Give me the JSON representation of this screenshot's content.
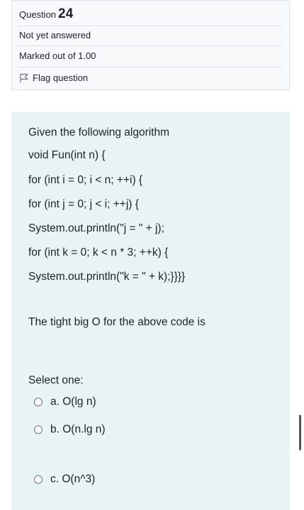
{
  "info": {
    "question_label": "Question",
    "question_number": "24",
    "state": "Not yet answered",
    "grade": "Marked out of 1.00",
    "flag_label": "Flag question"
  },
  "question": {
    "lines": [
      "Given the following algorithm",
      "void Fun(int n) {",
      "for (int i = 0; i < n; ++i) {",
      "for (int j = 0; j < i; ++j) {",
      "System.out.println(\"j = \" + j);",
      "for (int k = 0; k < n * 3; ++k) {",
      "System.out.println(\"k = \" + k);}}}}",
      "The tight big O for the above code is"
    ],
    "prompt": "Select one:",
    "options": [
      "a. O(lg n)",
      "b. O(n.lg n)",
      "c. O(n^3)"
    ]
  }
}
